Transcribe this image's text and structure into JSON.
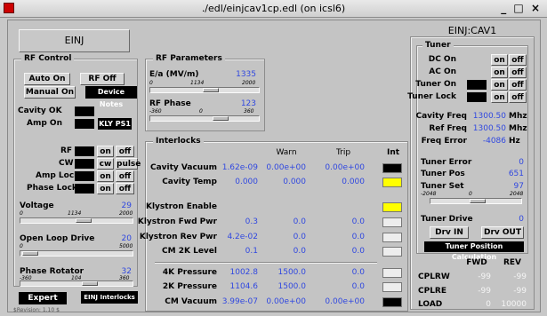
{
  "window": {
    "title": "./edl/einjcav1cp.edl (on icsl6)",
    "controls": "_ □ ×"
  },
  "left_header": "EINJ",
  "rf_control": {
    "title": "RF Control",
    "auto_on": "Auto On",
    "rf_off": "RF Off",
    "manual_on": "Manual On",
    "device_notes": "Device Notes",
    "cavity_ok": "Cavity OK",
    "amp_on": "Amp On",
    "kly_ps1": "KLY PS1",
    "rows": [
      {
        "label": "RF",
        "a": "on",
        "b": "off"
      },
      {
        "label": "CW",
        "a": "cw",
        "b": "pulse"
      },
      {
        "label": "Amp Lock",
        "a": "on",
        "b": "off"
      },
      {
        "label": "Phase Lock",
        "a": "on",
        "b": "off"
      }
    ],
    "voltage": {
      "label": "Voltage",
      "value": "29",
      "min": "0",
      "mid": "1134",
      "max": "2000",
      "level": 0.57
    },
    "open_loop": {
      "label": "Open Loop Drive",
      "value": "20",
      "min": "0",
      "max": "5000",
      "level": 0.02
    },
    "phase_rot": {
      "label": "Phase Rotator",
      "value": "32",
      "min": "-360",
      "mid": "104",
      "max": "360",
      "level": 0.64
    },
    "expert": "Expert",
    "einj_interlocks": "EINJ Interlocks",
    "revision": "$Revision: 1.10 $"
  },
  "rf_params": {
    "title": "RF Parameters",
    "ea": {
      "label": "E/a (MV/m)",
      "value": "1335",
      "min": "0",
      "mid": "1134",
      "max": "2000",
      "level": 0.57
    },
    "phase": {
      "label": "RF Phase",
      "value": "123",
      "min": "-360",
      "mid": "0",
      "max": "360",
      "level": 0.67
    }
  },
  "interlocks": {
    "title": "Interlocks",
    "headers": {
      "warn": "Warn",
      "trip": "Trip",
      "int": "Int"
    },
    "rows": [
      {
        "label": "Cavity Vacuum",
        "val": "1.62e-09",
        "warn": "0.00e+00",
        "trip": "0.00e+00",
        "ind": "black"
      },
      {
        "label": "Cavity Temp",
        "val": "0.000",
        "warn": "0.000",
        "trip": "0.000",
        "ind": "yellow"
      },
      {
        "label": "Klystron Enable",
        "val": "",
        "warn": "",
        "trip": "",
        "ind": "yellow"
      },
      {
        "label": "Klystron Fwd Pwr",
        "val": "0.3",
        "warn": "0.0",
        "trip": "0.0",
        "ind": "light"
      },
      {
        "label": "Klystron Rev Pwr",
        "val": "4.2e-02",
        "warn": "0.0",
        "trip": "0.0",
        "ind": "light"
      },
      {
        "label": "CM 2K Level",
        "val": "0.1",
        "warn": "0.0",
        "trip": "0.0",
        "ind": "light"
      },
      {
        "label": "4K Pressure",
        "val": "1002.8",
        "warn": "1500.0",
        "trip": "0.0",
        "ind": "light"
      },
      {
        "label": "2K Pressure",
        "val": "1104.6",
        "warn": "1500.0",
        "trip": "0.0",
        "ind": "light"
      },
      {
        "label": "CM Vacuum",
        "val": "3.99e-07",
        "warn": "0.00e+00",
        "trip": "0.00e+00",
        "ind": "black"
      }
    ]
  },
  "right_header": "EINJ:CAV1",
  "tuner": {
    "title": "Tuner",
    "rows": [
      {
        "label": "DC On",
        "a": "on",
        "b": "off"
      },
      {
        "label": "AC On",
        "a": "on",
        "b": "off"
      },
      {
        "label": "Tuner On",
        "a": "on",
        "b": "off"
      },
      {
        "label": "Tuner Lock",
        "a": "on",
        "b": "off"
      }
    ],
    "cavity_freq": {
      "label": "Cavity Freq",
      "value": "1300.50",
      "unit": "Mhz"
    },
    "ref_freq": {
      "label": "Ref Freq",
      "value": "1300.50",
      "unit": "Mhz"
    },
    "freq_error": {
      "label": "Freq Error",
      "value": "-4086",
      "unit": "Hz"
    },
    "tuner_error": {
      "label": "Tuner Error",
      "value": "0"
    },
    "tuner_pos": {
      "label": "Tuner Pos",
      "value": "651"
    },
    "tuner_set": {
      "label": "Tuner Set",
      "value": "97",
      "min": "-2048",
      "mid": "0",
      "max": "2048",
      "level": 0.52
    },
    "tuner_drive": {
      "label": "Tuner Drive",
      "value": "0"
    },
    "drv_in": "Drv IN",
    "drv_out": "Drv OUT",
    "tuner_calc": "Tuner Position Calculation"
  },
  "fwd_rev": {
    "fwd": "FWD",
    "rev": "REV",
    "rows": [
      {
        "label": "CPLRW",
        "fwd": "-99",
        "rev": "-99"
      },
      {
        "label": "CPLRE",
        "fwd": "-99",
        "rev": "-99"
      },
      {
        "label": "LOAD",
        "fwd": "0",
        "rev": "10000"
      }
    ]
  }
}
